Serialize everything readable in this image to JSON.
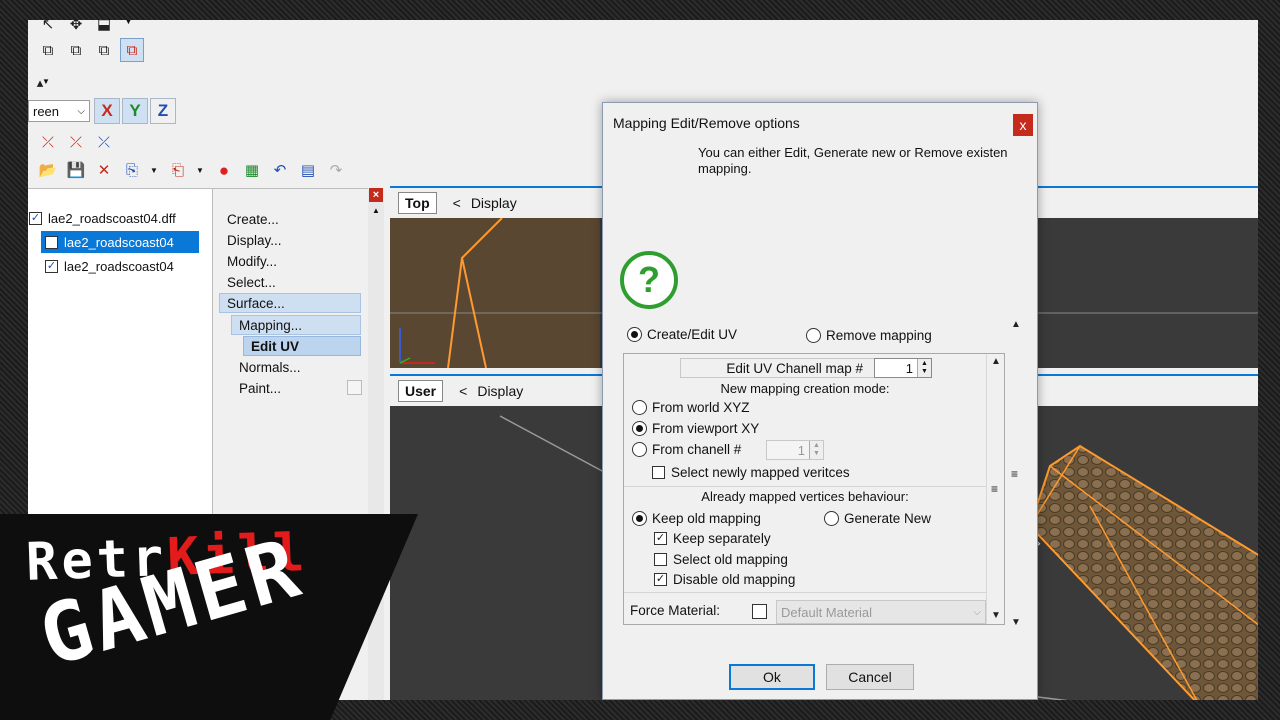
{
  "colors": {
    "accent": "#0a78d7",
    "close_red": "#c42b1c",
    "road_orange": "#ff9a2e",
    "viewport_bg": "#3a3a3a",
    "logo_red": "#e41b1b"
  },
  "toolbar": {
    "axis_dropdown_value": "reen",
    "axis_x": "X",
    "axis_y": "Y",
    "axis_z": "Z"
  },
  "tree": {
    "items": [
      {
        "label": "lae2_roadscoast04.dff",
        "checked": true
      },
      {
        "label": "lae2_roadscoast04",
        "checked": false,
        "selected": true
      },
      {
        "label": "lae2_roadscoast04",
        "checked": true
      }
    ]
  },
  "menu": {
    "create": "Create...",
    "display": "Display...",
    "modify": "Modify...",
    "select": "Select...",
    "surface": "Surface...",
    "mapping": "Mapping...",
    "edit_uv": "Edit UV",
    "normals": "Normals...",
    "paint": "Paint..."
  },
  "viewports": {
    "top": {
      "tag": "Top",
      "menu_arrow": "<",
      "menu": "Display"
    },
    "user": {
      "tag": "User",
      "menu_arrow": "<",
      "menu": "Display"
    }
  },
  "dialog": {
    "title": "Mapping Edit/Remove options",
    "close": "x",
    "message": "You can either Edit, Generate new or Remove existen mapping.",
    "mode_create_edit": "Create/Edit UV",
    "mode_remove": "Remove mapping",
    "channel_label": "Edit UV Chanell map #",
    "channel_value": "1",
    "creation_mode_header": "New mapping creation mode:",
    "from_world_xyz": "From world XYZ",
    "from_viewport_xy": "From viewport XY",
    "from_channel": "From chanell #",
    "from_channel_value": "1",
    "select_newly_mapped": "Select newly mapped veritces",
    "already_mapped_header": "Already mapped vertices behaviour:",
    "keep_old_mapping": "Keep old mapping",
    "generate_new": "Generate New",
    "keep_separately": "Keep separately",
    "select_old_mapping": "Select old mapping",
    "disable_old_mapping": "Disable old mapping",
    "force_material_label": "Force Material:",
    "force_material_value": "Default Material",
    "ok": "Ok",
    "cancel": "Cancel"
  },
  "watermark": {
    "line1_a": "Retr",
    "line1_b": "Kill",
    "line2": "GAMER"
  }
}
